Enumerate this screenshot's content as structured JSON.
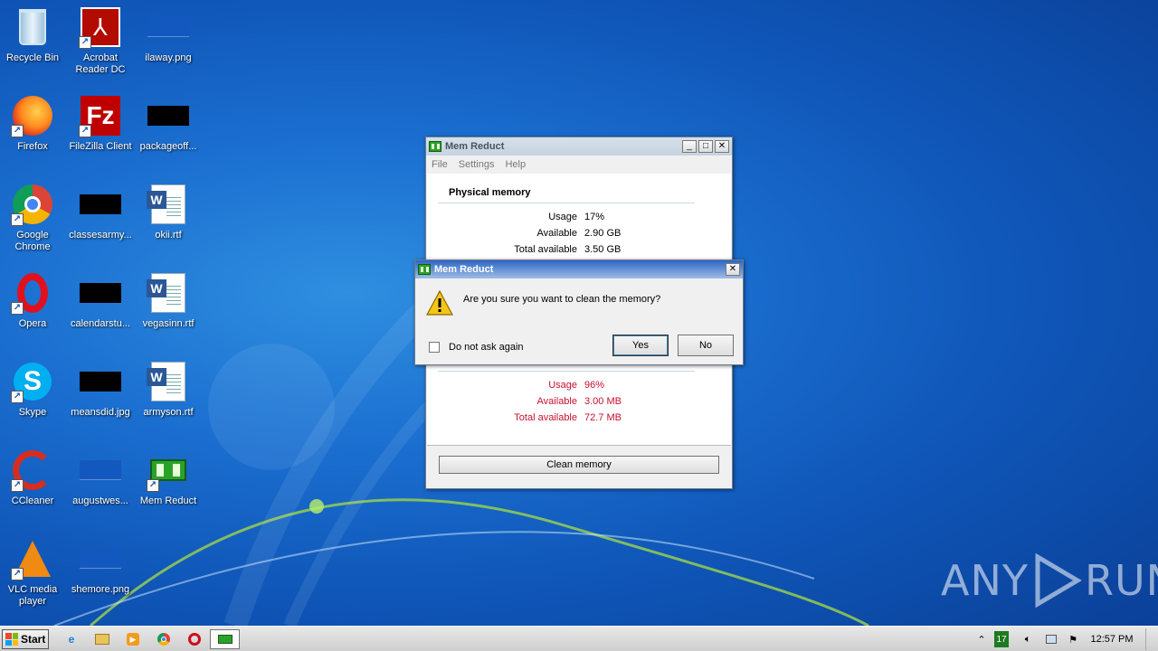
{
  "desktop": {
    "icons": [
      {
        "label": "Recycle Bin",
        "icon": "recycle-bin-icon"
      },
      {
        "label": "Acrobat Reader DC",
        "icon": "acrobat-icon"
      },
      {
        "label": "ilaway.png",
        "icon": "image-file-icon"
      },
      {
        "label": "Firefox",
        "icon": "firefox-icon"
      },
      {
        "label": "FileZilla Client",
        "icon": "filezilla-icon"
      },
      {
        "label": "packageoff...",
        "icon": "image-file-icon"
      },
      {
        "label": "Google Chrome",
        "icon": "chrome-icon"
      },
      {
        "label": "classesarmy...",
        "icon": "image-file-icon"
      },
      {
        "label": "okii.rtf",
        "icon": "word-doc-icon"
      },
      {
        "label": "Opera",
        "icon": "opera-icon"
      },
      {
        "label": "calendarstu...",
        "icon": "image-file-icon"
      },
      {
        "label": "vegasinn.rtf",
        "icon": "word-doc-icon"
      },
      {
        "label": "Skype",
        "icon": "skype-icon"
      },
      {
        "label": "meansdid.jpg",
        "icon": "image-file-icon"
      },
      {
        "label": "armyson.rtf",
        "icon": "word-doc-icon"
      },
      {
        "label": "CCleaner",
        "icon": "ccleaner-icon"
      },
      {
        "label": "augustwes...",
        "icon": "image-file-icon"
      },
      {
        "label": "Mem Reduct",
        "icon": "memreduct-icon"
      },
      {
        "label": "VLC media player",
        "icon": "vlc-icon"
      },
      {
        "label": "shemore.png",
        "icon": "image-file-icon"
      }
    ]
  },
  "main_window": {
    "title": "Mem Reduct",
    "menu": [
      "File",
      "Settings",
      "Help"
    ],
    "physical": {
      "section_title": "Physical memory",
      "usage_label": "Usage",
      "usage_value": "17%",
      "available_label": "Available",
      "available_value": "2.90 GB",
      "total_label": "Total available",
      "total_value": "3.50 GB"
    },
    "virtual": {
      "usage_label": "Usage",
      "usage_value": "96%",
      "available_label": "Available",
      "available_value": "3.00 MB",
      "total_label": "Total available",
      "total_value": "72.7 MB"
    },
    "clean_button": "Clean memory",
    "colors": {
      "warning": "#c8102e"
    }
  },
  "dialog": {
    "title": "Mem Reduct",
    "message": "Are you sure you want to clean the memory?",
    "checkbox_label": "Do not ask again",
    "checkbox_checked": false,
    "yes_label": "Yes",
    "no_label": "No"
  },
  "taskbar": {
    "start_label": "Start",
    "tray_badge": "17",
    "clock": "12:57 PM"
  },
  "watermark": {
    "left": "ANY",
    "right": "RUN"
  }
}
